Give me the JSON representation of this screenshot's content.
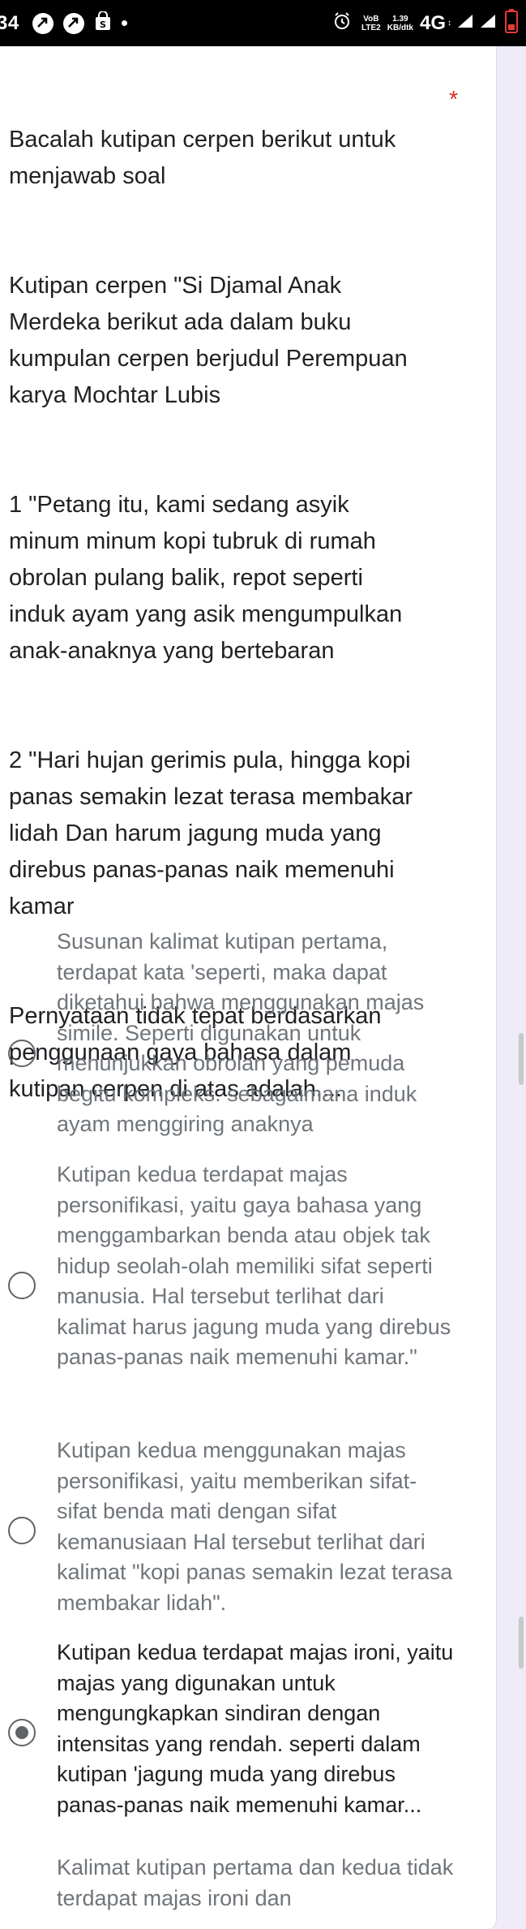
{
  "status_bar": {
    "time": "34",
    "lte_label_top": "VoB",
    "lte_label_bottom": "LTE2",
    "speed_top": "1.39",
    "speed_bottom": "KB/dtk",
    "network": "4G",
    "updown": "↕"
  },
  "question": {
    "paragraphs": [
      "Bacalah kutipan cerpen berikut untuk menjawab soal",
      "Kutipan cerpen \"Si Djamal Anak Merdeka berikut ada dalam buku kumpulan cerpen berjudul Perempuan karya Mochtar Lubis",
      " 1 \"Petang itu, kami sedang asyik minum minum kopi tubruk di rumah obrolan pulang  balik, repot seperti induk ayam yang asik mengumpulkan anak-anaknya yang bertebaran",
      " 2 \"Hari hujan gerimis pula, hingga kopi panas semakin lezat terasa membakar lidah Dan harum jagung muda yang direbus panas-panas naik memenuhi kamar",
      "Pernyataan tidak tepat berdasarkan penggunaan gaya bahasa dalam kutipan cerpen di atas adalah...."
    ],
    "required_mark": "*"
  },
  "options": [
    {
      "text": "Susunan kalimat kutipan pertama, terdapat kata 'seperti, maka dapat diketahui bahwa menggunakan majas simile. Seperti digunakan untuk menunjukkan obrolan yang pemuda begitu kompleks. sebagaimana induk ayam menggiring anaknya",
      "selected": false
    },
    {
      "text": "Kutipan kedua terdapat majas personifikasi, yaitu gaya bahasa yang menggambarkan benda atau objek tak hidup seolah-olah memiliki sifat seperti manusia. Hal tersebut terlihat dari kalimat harus jagung muda yang direbus panas-panas naik memenuhi kamar.\"",
      "selected": false
    },
    {
      "text": "Kutipan kedua menggunakan majas personifikasi, yaitu memberikan sifat-sifat benda mati dengan sifat kemanusiaan Hal tersebut terlihat dari kalimat \"kopi panas semakin lezat terasa membakar lidah\".",
      "selected": false
    },
    {
      "text": "Kutipan kedua terdapat majas ironi, yaitu majas yang digunakan untuk mengungkapkan sindiran dengan intensitas yang rendah. seperti dalam kutipan 'jagung muda yang direbus panas-panas naik memenuhi kamar...",
      "selected": true
    },
    {
      "text": "Kalimat kutipan pertama dan kedua tidak terdapat majas ironi dan",
      "selected": false
    }
  ],
  "colors": {
    "background": "#f0ebf8",
    "card": "#ffffff",
    "required": "#d93025",
    "text_primary": "#202124",
    "text_secondary": "#70757a"
  }
}
